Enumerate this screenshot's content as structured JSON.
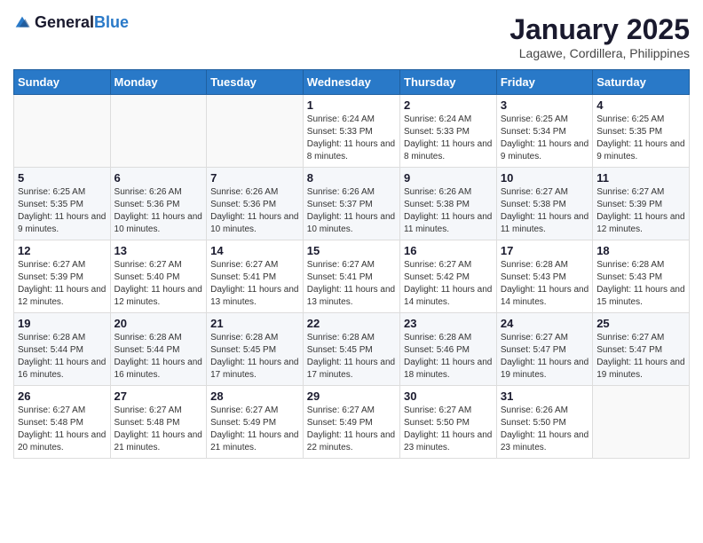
{
  "logo": {
    "general": "General",
    "blue": "Blue"
  },
  "title": "January 2025",
  "location": "Lagawe, Cordillera, Philippines",
  "weekdays": [
    "Sunday",
    "Monday",
    "Tuesday",
    "Wednesday",
    "Thursday",
    "Friday",
    "Saturday"
  ],
  "weeks": [
    [
      {
        "day": "",
        "info": ""
      },
      {
        "day": "",
        "info": ""
      },
      {
        "day": "",
        "info": ""
      },
      {
        "day": "1",
        "info": "Sunrise: 6:24 AM\nSunset: 5:33 PM\nDaylight: 11 hours and 8 minutes."
      },
      {
        "day": "2",
        "info": "Sunrise: 6:24 AM\nSunset: 5:33 PM\nDaylight: 11 hours and 8 minutes."
      },
      {
        "day": "3",
        "info": "Sunrise: 6:25 AM\nSunset: 5:34 PM\nDaylight: 11 hours and 9 minutes."
      },
      {
        "day": "4",
        "info": "Sunrise: 6:25 AM\nSunset: 5:35 PM\nDaylight: 11 hours and 9 minutes."
      }
    ],
    [
      {
        "day": "5",
        "info": "Sunrise: 6:25 AM\nSunset: 5:35 PM\nDaylight: 11 hours and 9 minutes."
      },
      {
        "day": "6",
        "info": "Sunrise: 6:26 AM\nSunset: 5:36 PM\nDaylight: 11 hours and 10 minutes."
      },
      {
        "day": "7",
        "info": "Sunrise: 6:26 AM\nSunset: 5:36 PM\nDaylight: 11 hours and 10 minutes."
      },
      {
        "day": "8",
        "info": "Sunrise: 6:26 AM\nSunset: 5:37 PM\nDaylight: 11 hours and 10 minutes."
      },
      {
        "day": "9",
        "info": "Sunrise: 6:26 AM\nSunset: 5:38 PM\nDaylight: 11 hours and 11 minutes."
      },
      {
        "day": "10",
        "info": "Sunrise: 6:27 AM\nSunset: 5:38 PM\nDaylight: 11 hours and 11 minutes."
      },
      {
        "day": "11",
        "info": "Sunrise: 6:27 AM\nSunset: 5:39 PM\nDaylight: 11 hours and 12 minutes."
      }
    ],
    [
      {
        "day": "12",
        "info": "Sunrise: 6:27 AM\nSunset: 5:39 PM\nDaylight: 11 hours and 12 minutes."
      },
      {
        "day": "13",
        "info": "Sunrise: 6:27 AM\nSunset: 5:40 PM\nDaylight: 11 hours and 12 minutes."
      },
      {
        "day": "14",
        "info": "Sunrise: 6:27 AM\nSunset: 5:41 PM\nDaylight: 11 hours and 13 minutes."
      },
      {
        "day": "15",
        "info": "Sunrise: 6:27 AM\nSunset: 5:41 PM\nDaylight: 11 hours and 13 minutes."
      },
      {
        "day": "16",
        "info": "Sunrise: 6:27 AM\nSunset: 5:42 PM\nDaylight: 11 hours and 14 minutes."
      },
      {
        "day": "17",
        "info": "Sunrise: 6:28 AM\nSunset: 5:43 PM\nDaylight: 11 hours and 14 minutes."
      },
      {
        "day": "18",
        "info": "Sunrise: 6:28 AM\nSunset: 5:43 PM\nDaylight: 11 hours and 15 minutes."
      }
    ],
    [
      {
        "day": "19",
        "info": "Sunrise: 6:28 AM\nSunset: 5:44 PM\nDaylight: 11 hours and 16 minutes."
      },
      {
        "day": "20",
        "info": "Sunrise: 6:28 AM\nSunset: 5:44 PM\nDaylight: 11 hours and 16 minutes."
      },
      {
        "day": "21",
        "info": "Sunrise: 6:28 AM\nSunset: 5:45 PM\nDaylight: 11 hours and 17 minutes."
      },
      {
        "day": "22",
        "info": "Sunrise: 6:28 AM\nSunset: 5:45 PM\nDaylight: 11 hours and 17 minutes."
      },
      {
        "day": "23",
        "info": "Sunrise: 6:28 AM\nSunset: 5:46 PM\nDaylight: 11 hours and 18 minutes."
      },
      {
        "day": "24",
        "info": "Sunrise: 6:27 AM\nSunset: 5:47 PM\nDaylight: 11 hours and 19 minutes."
      },
      {
        "day": "25",
        "info": "Sunrise: 6:27 AM\nSunset: 5:47 PM\nDaylight: 11 hours and 19 minutes."
      }
    ],
    [
      {
        "day": "26",
        "info": "Sunrise: 6:27 AM\nSunset: 5:48 PM\nDaylight: 11 hours and 20 minutes."
      },
      {
        "day": "27",
        "info": "Sunrise: 6:27 AM\nSunset: 5:48 PM\nDaylight: 11 hours and 21 minutes."
      },
      {
        "day": "28",
        "info": "Sunrise: 6:27 AM\nSunset: 5:49 PM\nDaylight: 11 hours and 21 minutes."
      },
      {
        "day": "29",
        "info": "Sunrise: 6:27 AM\nSunset: 5:49 PM\nDaylight: 11 hours and 22 minutes."
      },
      {
        "day": "30",
        "info": "Sunrise: 6:27 AM\nSunset: 5:50 PM\nDaylight: 11 hours and 23 minutes."
      },
      {
        "day": "31",
        "info": "Sunrise: 6:26 AM\nSunset: 5:50 PM\nDaylight: 11 hours and 23 minutes."
      },
      {
        "day": "",
        "info": ""
      }
    ]
  ]
}
